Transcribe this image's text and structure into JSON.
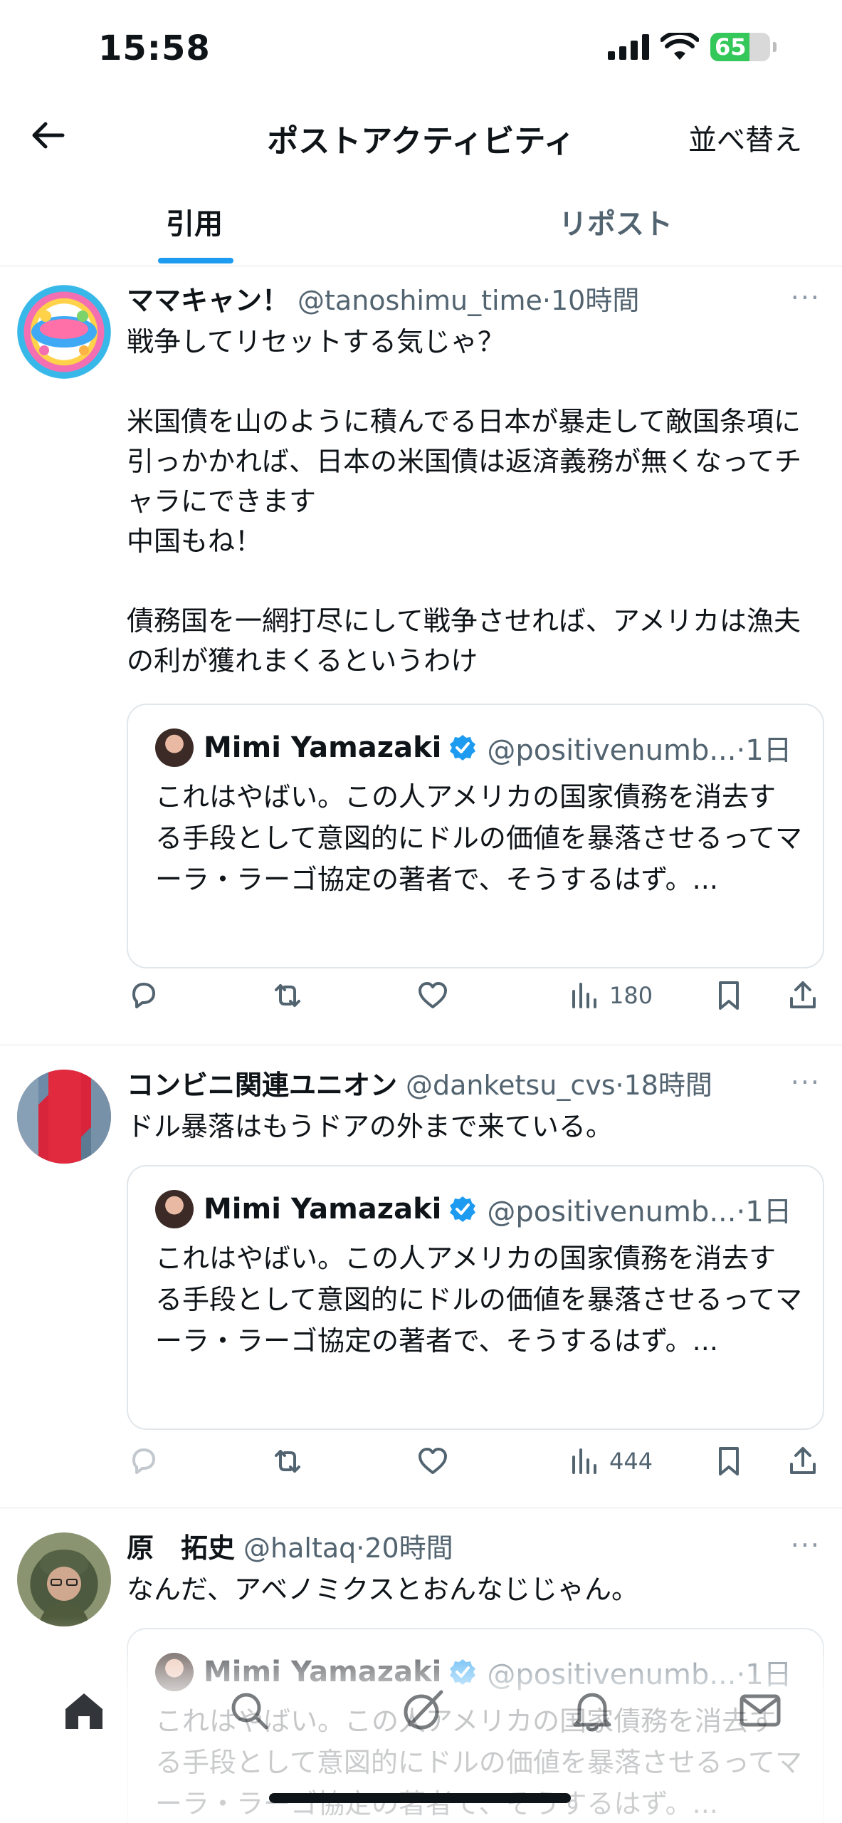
{
  "status_bar": {
    "time": "15:58",
    "battery": "65",
    "battery_level": 0.65
  },
  "header": {
    "title": "ポストアクティビティ",
    "sort_label": "並べ替え"
  },
  "tabs": [
    {
      "label": "引用",
      "active": true
    },
    {
      "label": "リポスト",
      "active": false
    }
  ],
  "quoted_post": {
    "name": "Mimi Yamazaki",
    "handle_time": "@positivenumb...·1日",
    "text": "これはやばい。この人アメリカの国家債務を消去する手段として意図的にドルの価値を暴落させるってマーラ・ラーゴ協定の著者で、そうするはず。..."
  },
  "posts": [
    {
      "name": "ママキャン！",
      "meta": "@tanoshimu_time·10時間",
      "text": "戦争してリセットする気じゃ？\n\n米国債を山のように積んでる日本が暴走して敵国条項に引っかかれば、日本の米国債は返済義務が無くなってチャラにできます\n中国もね！\n\n債務国を一網打尽にして戦争させれば、アメリカは漁夫の利が獲れまくるというわけ",
      "views": "180"
    },
    {
      "name": "コンビニ関連ユニオン",
      "meta": "@danketsu_cvs·18時間",
      "text": "ドル暴落はもうドアの外まで来ている。",
      "views": "444"
    },
    {
      "name": "原　拓史",
      "meta": "@haltaq·20時間",
      "text": "なんだ、アベノミクスとおんなじじゃん。"
    }
  ],
  "icons": {
    "more": "···",
    "accent": "#1d9bf0",
    "verified_color": "#1d9bf0"
  }
}
